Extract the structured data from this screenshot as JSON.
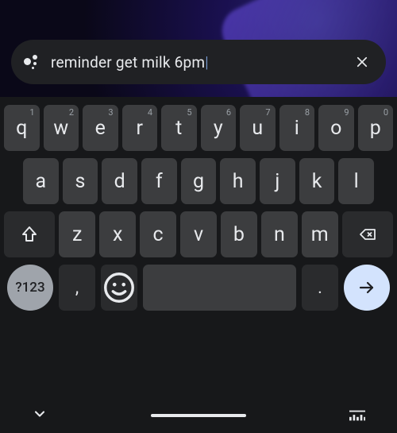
{
  "search": {
    "query": "reminder get milk 6pm"
  },
  "keyboard": {
    "row1": [
      {
        "letter": "q",
        "hint": "1"
      },
      {
        "letter": "w",
        "hint": "2"
      },
      {
        "letter": "e",
        "hint": "3"
      },
      {
        "letter": "r",
        "hint": "4"
      },
      {
        "letter": "t",
        "hint": "5"
      },
      {
        "letter": "y",
        "hint": "6"
      },
      {
        "letter": "u",
        "hint": "7"
      },
      {
        "letter": "i",
        "hint": "8"
      },
      {
        "letter": "o",
        "hint": "9"
      },
      {
        "letter": "p",
        "hint": "0"
      }
    ],
    "row2": [
      {
        "letter": "a"
      },
      {
        "letter": "s"
      },
      {
        "letter": "d"
      },
      {
        "letter": "f"
      },
      {
        "letter": "g"
      },
      {
        "letter": "h"
      },
      {
        "letter": "j"
      },
      {
        "letter": "k"
      },
      {
        "letter": "l"
      }
    ],
    "row3": [
      {
        "letter": "z"
      },
      {
        "letter": "x"
      },
      {
        "letter": "c"
      },
      {
        "letter": "v"
      },
      {
        "letter": "b"
      },
      {
        "letter": "n"
      },
      {
        "letter": "m"
      }
    ],
    "symbols_label": "?123",
    "comma": ",",
    "period": "."
  }
}
